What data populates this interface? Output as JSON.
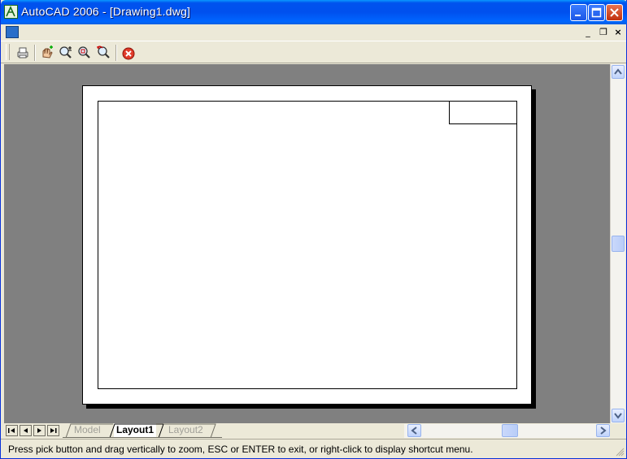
{
  "window": {
    "title": "AutoCAD 2006 - [Drawing1.dwg]"
  },
  "toolbar": {
    "tools": [
      "plot-icon",
      "pan-icon",
      "zoom-realtime-icon",
      "zoom-window-icon",
      "zoom-previous-icon",
      "close-preview-icon"
    ]
  },
  "layout_tabs": [
    "Model",
    "Layout1",
    "Layout2"
  ],
  "active_tab": "Layout1",
  "status": {
    "message": "Press pick button and drag vertically to zoom, ESC or ENTER to exit, or right-click to display shortcut menu."
  },
  "colors": {
    "canvas": "#808080",
    "paper": "#ffffff",
    "titlebar": "#0054e3"
  }
}
